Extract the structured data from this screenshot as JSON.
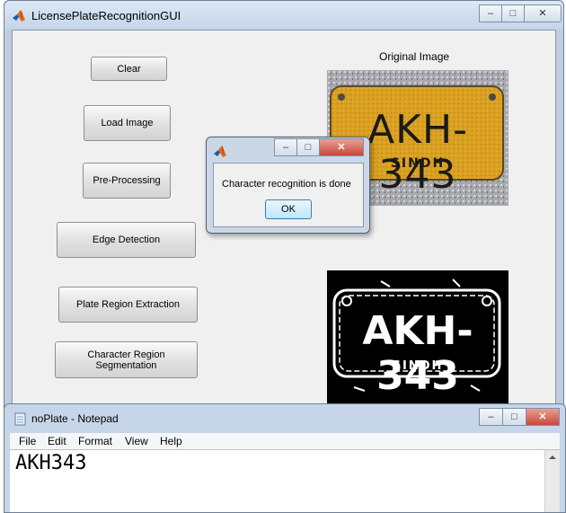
{
  "gui": {
    "title": "LicensePlateRecognitionGUI",
    "buttons": {
      "clear": "Clear",
      "load_image": "Load Image",
      "pre_processing": "Pre-Processing",
      "edge_detection": "Edge Detection",
      "plate_region": "Plate Region Extraction",
      "char_segmentation": "Character Region Segmentation"
    },
    "original_image_title": "Original Image",
    "plate_text": "AKH-343",
    "plate_region": "SINDH"
  },
  "dialog": {
    "message": "Character recognition is done",
    "ok": "OK"
  },
  "notepad": {
    "title": "noPlate - Notepad",
    "menu": [
      "File",
      "Edit",
      "Format",
      "View",
      "Help"
    ],
    "content": "AKH343"
  },
  "caption_glyphs": {
    "minimize": "–",
    "maximize": "□",
    "close": "✕"
  },
  "colors": {
    "plate_yellow": "#d9a021",
    "accent_close": "#c9473c"
  },
  "icons": [
    "matlab-icon",
    "notepad-icon"
  ]
}
